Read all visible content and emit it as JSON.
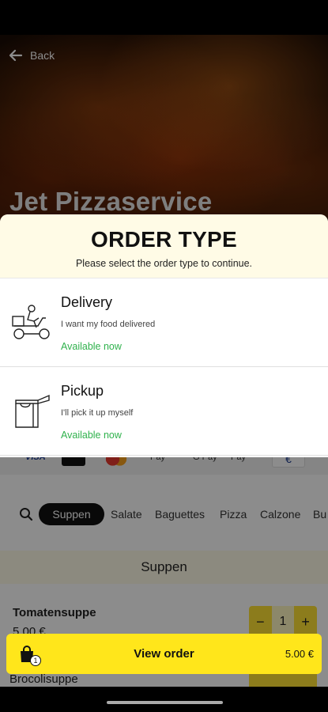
{
  "header": {
    "back_label": "Back",
    "restaurant_name": "Jet Pizzaservice"
  },
  "payments": [
    "VISA",
    "",
    "",
    "Pay",
    "G Pay",
    "Pay",
    "€"
  ],
  "categories": {
    "active": "Suppen",
    "items": [
      "Salate",
      "Baguettes",
      "Pizza",
      "Calzone",
      "Bu"
    ]
  },
  "section": {
    "title": "Suppen"
  },
  "menu_items": [
    {
      "name": "Tomatensuppe",
      "price": "5.00 €",
      "quantity": "1"
    },
    {
      "name": "Brocolisuppe"
    }
  ],
  "order_sheet": {
    "title": "ORDER TYPE",
    "subtitle": "Please select the order type to continue.",
    "options": [
      {
        "name": "Delivery",
        "description": "I want my food delivered",
        "status": "Available now",
        "icon": "scooter-delivery-icon"
      },
      {
        "name": "Pickup",
        "description": "I'll pick it up myself",
        "status": "Available now",
        "icon": "pickup-bag-icon"
      }
    ]
  },
  "view_order": {
    "label": "View order",
    "total": "5.00 €",
    "count": "1"
  },
  "colors": {
    "accent": "#ffe61b",
    "available": "#2fb24c",
    "sheet_header": "#fffbe6"
  }
}
